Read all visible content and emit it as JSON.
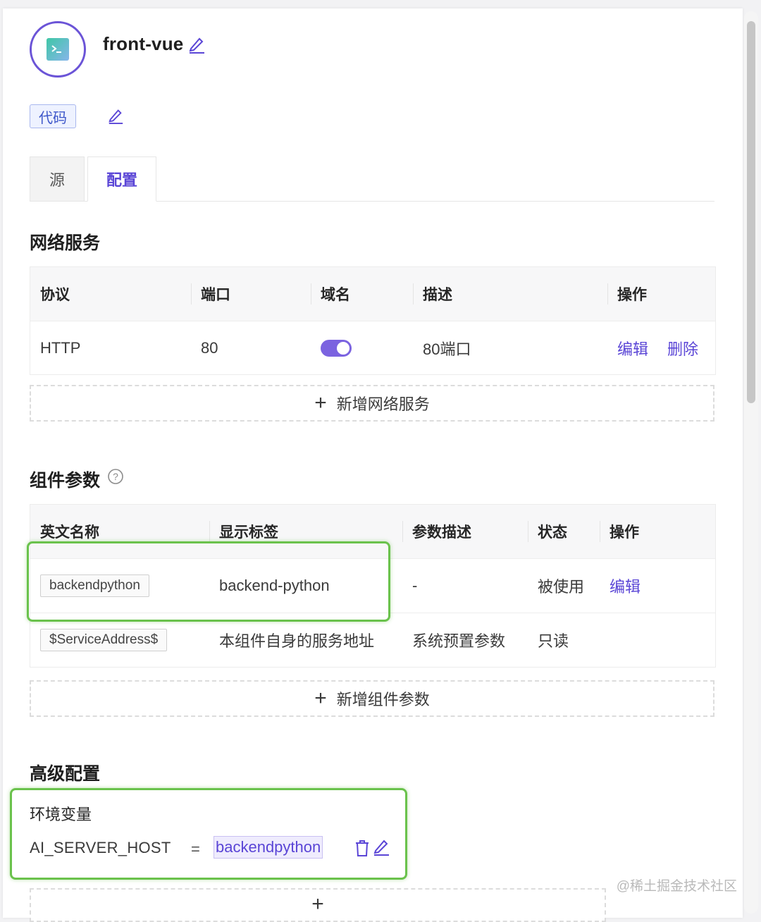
{
  "header": {
    "title": "front-vue"
  },
  "tag": {
    "label": "代码"
  },
  "tabs": [
    {
      "label": "源"
    },
    {
      "label": "配置"
    }
  ],
  "network": {
    "title": "网络服务",
    "columns": [
      "协议",
      "端口",
      "域名",
      "描述",
      "操作"
    ],
    "rows": [
      {
        "protocol": "HTTP",
        "port": "80",
        "domain_enabled": true,
        "desc": "80端口",
        "actions": [
          "编辑",
          "删除"
        ]
      }
    ],
    "add_label": "新增网络服务"
  },
  "params": {
    "title": "组件参数",
    "help_icon": "question-circle-icon",
    "columns": [
      "英文名称",
      "显示标签",
      "参数描述",
      "状态",
      "操作"
    ],
    "rows": [
      {
        "name": "backendpython",
        "label": "backend-python",
        "desc": "-",
        "status": "被使用",
        "action": "编辑"
      },
      {
        "name": "$ServiceAddress$",
        "label": "本组件自身的服务地址",
        "desc": "系统预置参数",
        "status": "只读",
        "action": ""
      }
    ],
    "add_label": "新增组件参数"
  },
  "advanced": {
    "title": "高级配置",
    "env_title": "环境变量",
    "env": {
      "key": "AI_SERVER_HOST",
      "op": "=",
      "value": "backendpython"
    },
    "add_symbol": "+"
  },
  "watermark": "@稀土掘金技术社区",
  "colors": {
    "accent": "#5a45d6",
    "highlight": "#6ac24c",
    "toggle": "#7b63e0"
  }
}
